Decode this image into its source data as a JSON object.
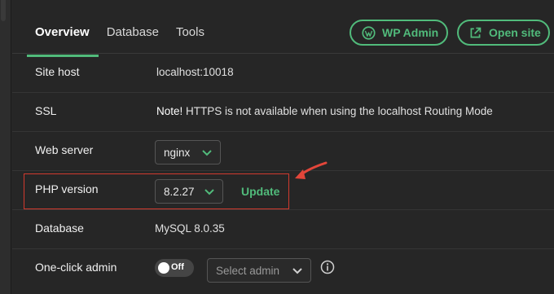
{
  "tabs": [
    {
      "label": "Overview",
      "active": true
    },
    {
      "label": "Database",
      "active": false
    },
    {
      "label": "Tools",
      "active": false
    }
  ],
  "header_buttons": {
    "wp_admin": {
      "label": "WP Admin",
      "icon": "wordpress-icon"
    },
    "open_site": {
      "label": "Open site",
      "icon": "external-link-icon"
    }
  },
  "rows": {
    "site_host": {
      "label": "Site host",
      "value": "localhost:10018"
    },
    "ssl": {
      "label": "SSL",
      "note_prefix": "Note!",
      "note_text": " HTTPS is not available when using the localhost Routing Mode"
    },
    "web_server": {
      "label": "Web server",
      "selected": "nginx"
    },
    "php_version": {
      "label": "PHP version",
      "selected": "8.2.27",
      "update_label": "Update"
    },
    "database": {
      "label": "Database",
      "value": "MySQL 8.0.35"
    },
    "one_click_admin": {
      "label": "One-click admin",
      "toggle_label": "Off",
      "toggle_on": false,
      "select_placeholder": "Select admin"
    }
  },
  "colors": {
    "accent": "#51bb7b",
    "background": "#262626",
    "annotation_red": "#d23a2e"
  }
}
